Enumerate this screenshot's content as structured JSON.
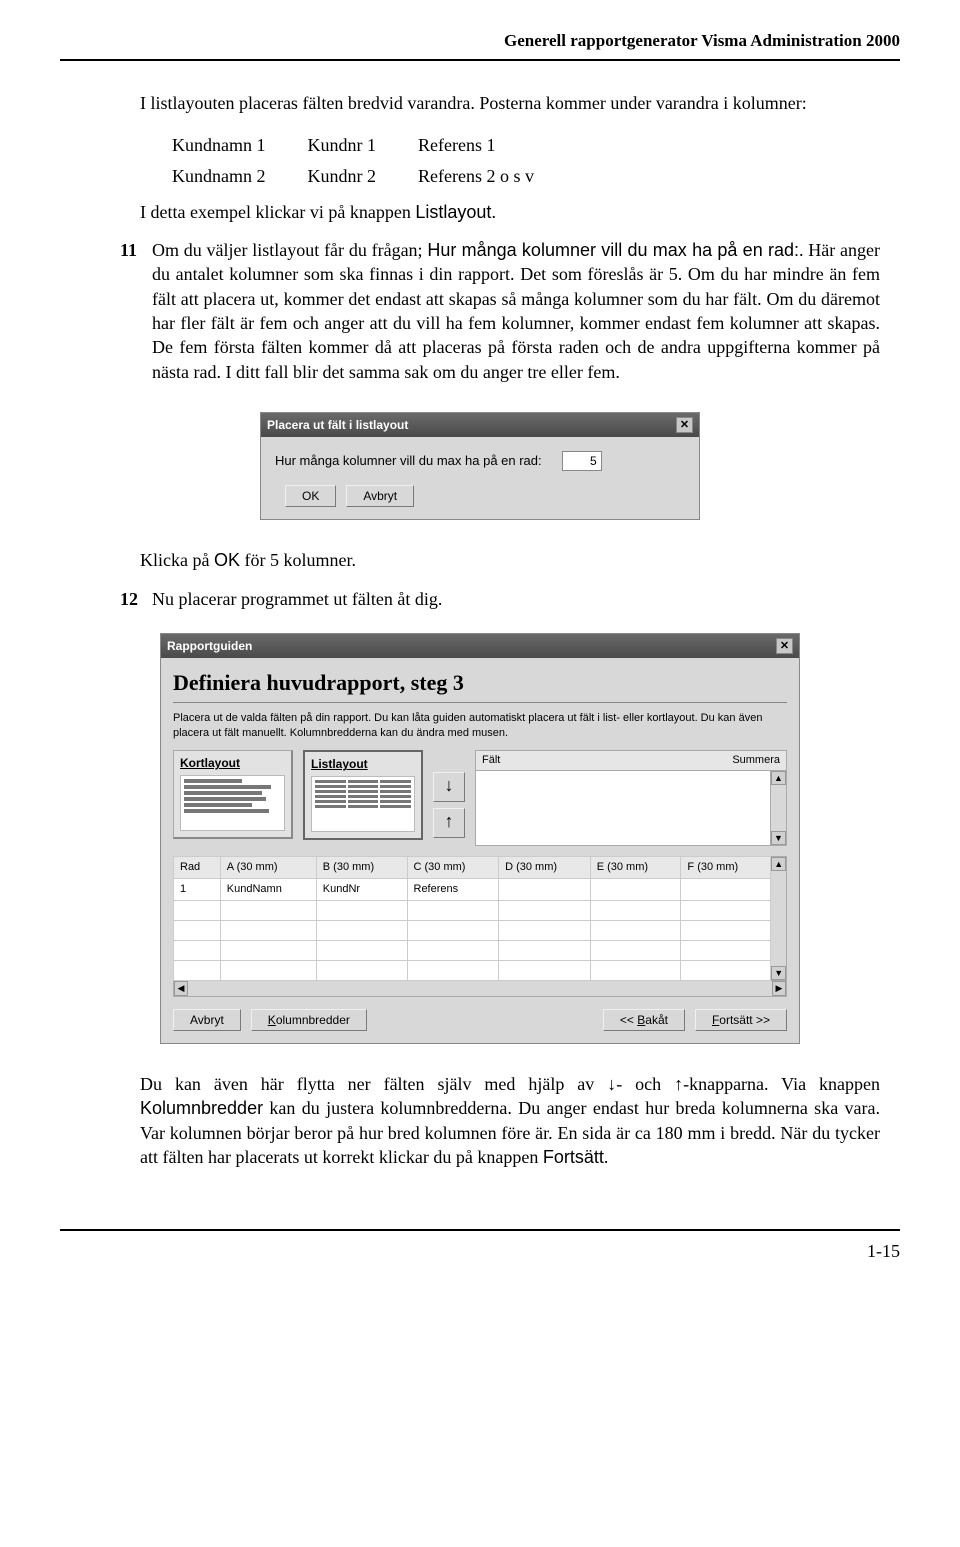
{
  "header": {
    "title": "Generell rapportgenerator Visma Administration 2000"
  },
  "intro": {
    "line1": "I listlayouten  placeras fälten bredvid varandra. Posterna kommer under varandra i kolumner:",
    "table": {
      "r1c1": "Kundnamn 1",
      "r1c2": "Kundnr 1",
      "r1c3": "Referens 1",
      "r2c1": "Kundnamn 2",
      "r2c2": "Kundnr 2",
      "r2c3": "Referens 2 o s v"
    },
    "line2a": "I detta exempel klickar vi på knappen ",
    "line2b": "Listlayout",
    "line2c": "."
  },
  "item11": {
    "num": "11",
    "txt1": "Om du väljer listlayout får du frågan; ",
    "txt2": "Hur många kolumner vill du max ha på en rad:",
    "txt3": ". Här anger du antalet kolumner som ska finnas i din rapport. Det som föreslås är 5. Om du har mindre än fem fält att placera ut, kommer det endast att skapas så många kolumner som du har fält. Om du däremot har fler fält är fem och anger att du vill ha fem kolumner, kommer endast fem kolumner att skapas. De fem första fälten kommer då att placeras på första raden och de andra uppgifterna kommer på nästa rad. I ditt fall blir det samma sak om du anger tre eller fem."
  },
  "dialog1": {
    "title": "Placera ut fält i listlayout",
    "prompt": "Hur många kolumner vill du max ha på en rad:",
    "value": "5",
    "ok": "OK",
    "cancel": "Avbryt"
  },
  "after1a": "Klicka på ",
  "after1b": "OK",
  "after1c": " för 5 kolumner.",
  "item12": {
    "num": "12",
    "txt": "Nu placerar programmet ut fälten åt dig."
  },
  "dialog2": {
    "title": "Rapportguiden",
    "step_title": "Definiera huvudrapport, steg 3",
    "desc": "Placera ut de valda fälten på din rapport.\nDu kan låta guiden automatiskt placera ut fält i list- eller kortlayout. Du kan även placera ut fält manuellt. Kolumnbredderna kan du ändra med musen.",
    "kort": "Kortlayout",
    "list": "Listlayout",
    "falt": "Fält",
    "summera": "Summera",
    "cols": [
      "Rad",
      "A (30 mm)",
      "B (30 mm)",
      "C (30 mm)",
      "D (30 mm)",
      "E (30 mm)",
      "F (30 mm)"
    ],
    "row1": [
      "1",
      "KundNamn",
      "KundNr",
      "Referens",
      "",
      "",
      ""
    ],
    "btn_avbryt": "Avbryt",
    "btn_kol": "Kolumnbredder",
    "btn_bak": "<< Bakåt",
    "btn_fort": "Fortsätt >>"
  },
  "tail": {
    "t1": "Du kan även här flytta ner fälten själv med hjälp av ↓- och ↑-knapparna. Via knappen ",
    "t2": "Kolumnbredder",
    "t3": " kan du justera kolumnbredderna. Du anger endast hur breda kolumnerna ska vara. Var kolumnen börjar beror på hur bred kolumnen före är. En sida är ca 180 mm i bredd. När du tycker att fälten har placerats ut korrekt klickar du på knappen ",
    "t4": "Fortsätt",
    "t5": "."
  },
  "footer": {
    "page": "1-15"
  }
}
